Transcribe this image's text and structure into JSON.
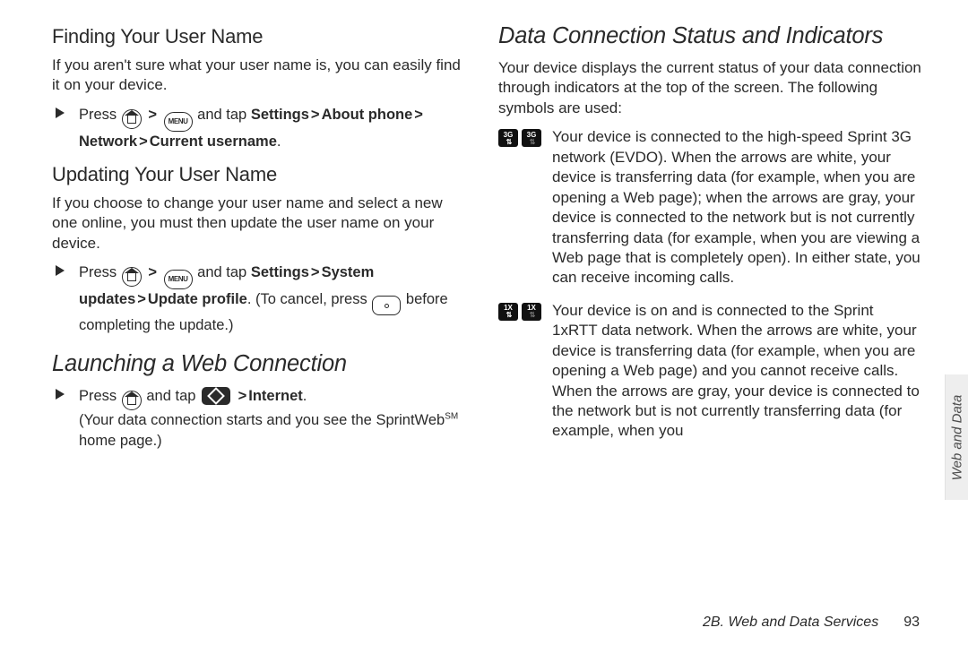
{
  "left": {
    "h2_finding": "Finding Your User Name",
    "p_finding": "If you aren't sure what your user name is, you can easily find it on your device.",
    "step_finding": {
      "press": "Press",
      "tap": "and tap",
      "path1": "Settings",
      "path2": "About phone",
      "path3": "Network",
      "path4": "Current username"
    },
    "h2_updating": "Updating Your User Name",
    "p_updating": "If you choose to change your user name and select a new one online, you must then update the user name on your device.",
    "step_updating": {
      "press": "Press",
      "tap": "and tap",
      "path1": "Settings",
      "path2": "System updates",
      "path3": "Update profile",
      "tail1": ". (To cancel, press",
      "tail2": "before completing the update.)"
    },
    "h1_launching": "Launching a Web Connection",
    "step_launch": {
      "press": "Press",
      "tap": "and tap",
      "internet": "Internet",
      "tail": "(Your data connection starts and you see the SprintWeb",
      "sm": "SM",
      "tail2": " home page.)"
    }
  },
  "right": {
    "h1": "Data Connection Status and Indicators",
    "intro": "Your device displays the current status of your data connection through indicators at the top of the screen. The following symbols are used:",
    "ind3g_a": "3G",
    "ind3g_text": "Your device is connected to the high-speed Sprint 3G network (EVDO). When the arrows are white, your device is transferring data (for example, when you are opening a Web page); when the arrows are gray, your device is connected to the network but is not currently transferring data (for example, when you are viewing a Web page that is completely open). In either state, you can receive incoming calls.",
    "ind1x_a": "1X",
    "ind1x_text": "Your device is on and is connected to the Sprint 1xRTT data network. When the arrows are white, your device is transferring data (for example, when you are opening a Web page) and you cannot receive calls. When the arrows are gray, your device is connected to the network but is not currently transferring data (for example, when you"
  },
  "side_tab": "Web and Data",
  "footer_section": "2B. Web and Data Services",
  "footer_page": "93"
}
